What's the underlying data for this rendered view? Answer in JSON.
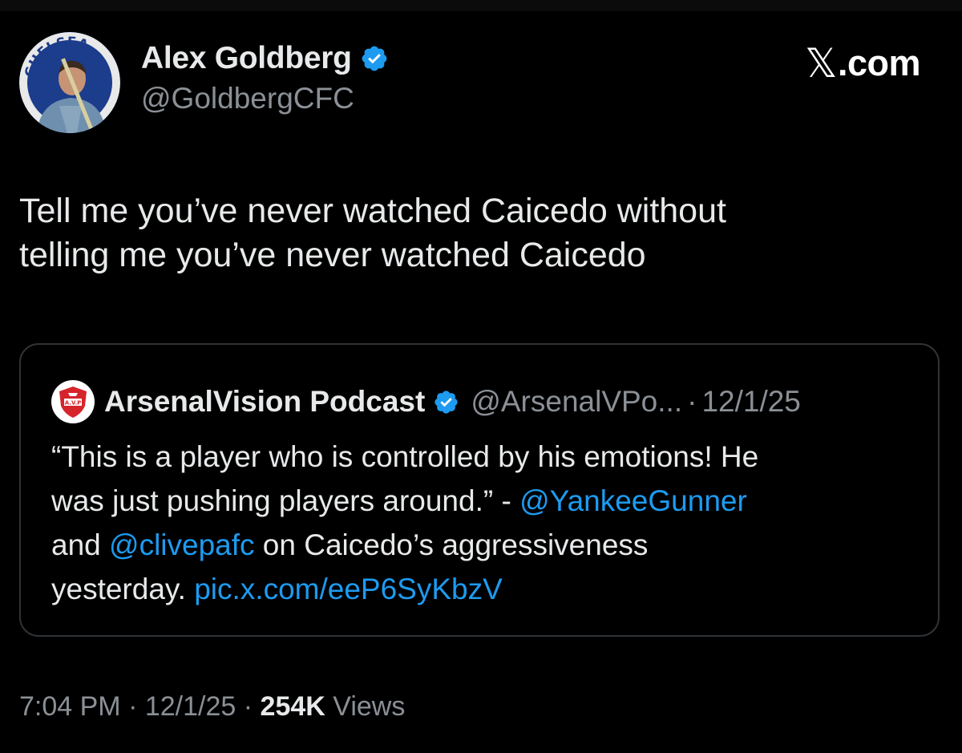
{
  "author": {
    "display_name": "Alex Goldberg",
    "handle": "@GoldbergCFC",
    "avatar_text": "CHELSEA",
    "verified_icon": "verified-badge-icon"
  },
  "site": {
    "logo_mark": "𝕏",
    "logo_text": ".com"
  },
  "tweet": {
    "line_1": "Tell me you’ve never watched Caicedo without",
    "line_2": "telling me you’ve never watched Caicedo"
  },
  "quote": {
    "avatar_text": "A.V.P",
    "name": "ArsenalVision Podcast",
    "handle": "@ArsenalVPo...",
    "separator": "·",
    "date": "12/1/25",
    "line_1": "“This is a player who is controlled by his emotions! He",
    "line_2_text": "was just pushing players around.” - ",
    "mention_1": "@YankeeGunner",
    "line_3_start": "and ",
    "mention_2": "@clivepafc",
    "line_3_end": " on Caicedo’s aggressiveness",
    "line_4_text": "yesterday. ",
    "pic_link": "pic.x.com/eeP6SyKbzV"
  },
  "footer": {
    "time": "7:04 PM",
    "separator": "·",
    "date": "12/1/25",
    "views_count": "254K",
    "views_label": "Views"
  },
  "colors": {
    "background": "#000000",
    "text": "#e7e9ea",
    "muted": "#8b9096",
    "link": "#1d9bf0",
    "verified": "#1d9bf0",
    "border": "#2f3336"
  }
}
